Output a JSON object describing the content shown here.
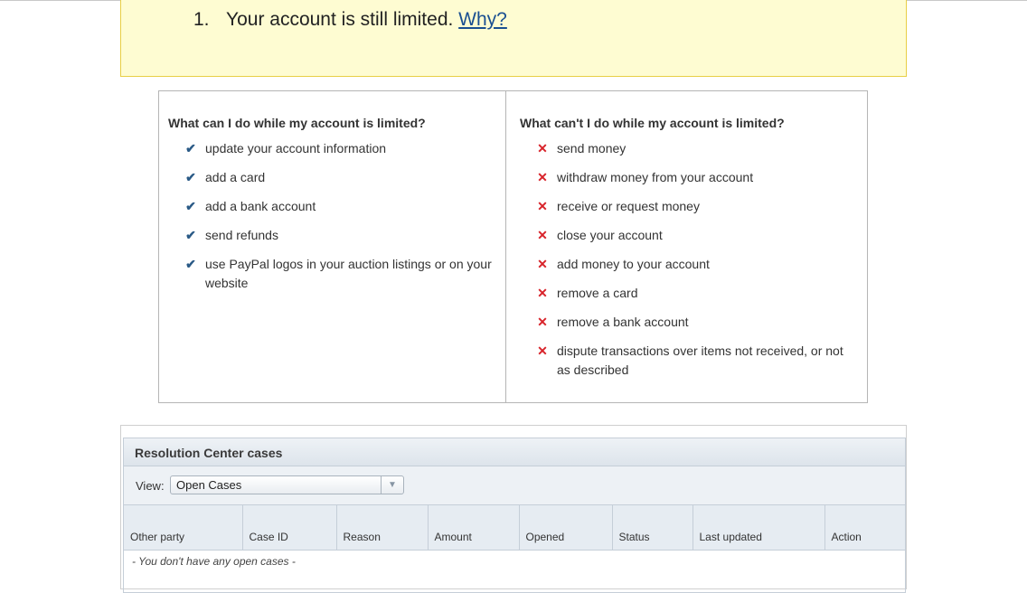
{
  "notice": {
    "number": "1.",
    "text": "Your account is still limited. ",
    "link_label": "Why?"
  },
  "limits": {
    "can": {
      "heading": "What can I do while my account is limited?",
      "items": [
        "update your account information",
        "add a card",
        "add a bank account",
        "send refunds",
        "use PayPal logos in your auction listings or on your website"
      ]
    },
    "cant": {
      "heading": "What can't I do while my account is limited?",
      "items": [
        "send money",
        "withdraw money from your account",
        "receive or request money",
        "close your account",
        "add money to your account",
        "remove a card",
        "remove a bank account",
        "dispute transactions over items not received, or not as described"
      ]
    },
    "check_icon": "checkmark-icon",
    "cross_icon": "x-icon",
    "colors": {
      "check": "#2a5a86",
      "cross": "#d8232a"
    }
  },
  "resolution": {
    "title": "Resolution Center cases",
    "view_label": "View:",
    "view_value": "Open Cases",
    "columns": [
      "Other party",
      "Case ID",
      "Reason",
      "Amount",
      "Opened",
      "Status",
      "Last updated",
      "Action"
    ],
    "empty_message": "- You don't have any open cases -"
  },
  "colors": {
    "notice_bg": "#fefcd2",
    "notice_border": "#e8cf46",
    "link": "#1a4f91"
  }
}
